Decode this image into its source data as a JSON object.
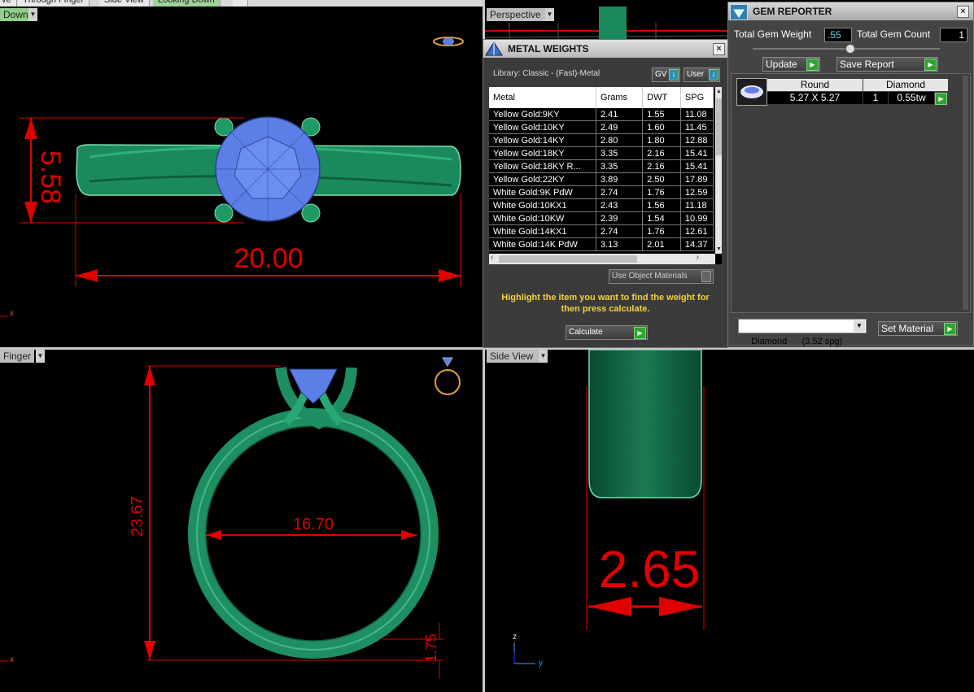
{
  "tabs": [
    {
      "label": "ve"
    },
    {
      "label": "Through Finger"
    },
    {
      "label": "Side View"
    },
    {
      "label": "Looking Down"
    }
  ],
  "viewports": {
    "top_left": {
      "label": "Down",
      "dim_height": "5.58",
      "dim_width": "20.00",
      "axis": "x"
    },
    "top_right": {
      "label": "Perspective"
    },
    "bottom_left": {
      "label": "Finger",
      "dim_height": "23.67",
      "dim_inner": "16.70",
      "dim_band": "1.75",
      "axis": "x"
    },
    "bottom_right": {
      "label": "Side View",
      "dim_width": "2.65",
      "axis_z": "z",
      "axis_y": "y"
    }
  },
  "metal_weights": {
    "title": "METAL WEIGHTS",
    "library": "Library: Classic - (Fast)-Metal",
    "gv_label": "GV",
    "user_label": "User",
    "columns": [
      "Metal",
      "Grams",
      "DWT",
      "SPG"
    ],
    "rows": [
      [
        "Yellow Gold:9KY",
        "2.41",
        "1.55",
        "11.08"
      ],
      [
        "Yellow Gold:10KY",
        "2.49",
        "1.60",
        "11.45"
      ],
      [
        "Yellow Gold:14KY",
        "2.80",
        "1.80",
        "12.88"
      ],
      [
        "Yellow Gold:18KY",
        "3.35",
        "2.16",
        "15.41"
      ],
      [
        "Yellow Gold:18KY R...",
        "3.35",
        "2.16",
        "15.41"
      ],
      [
        "Yellow Gold:22KY",
        "3.89",
        "2.50",
        "17.89"
      ],
      [
        "White Gold:9K PdW",
        "2.74",
        "1.76",
        "12.59"
      ],
      [
        "White Gold:10KX1",
        "2.43",
        "1.56",
        "11.18"
      ],
      [
        "White Gold:10KW",
        "2.39",
        "1.54",
        "10.99"
      ],
      [
        "White Gold:14KX1",
        "2.74",
        "1.76",
        "12.61"
      ],
      [
        "White Gold:14K PdW",
        "3.13",
        "2.01",
        "14.37"
      ]
    ],
    "use_object_materials": "Use Object Materials",
    "instruction": "Highlight the item you want to find the weight for then press calculate.",
    "calculate_label": "Calculate"
  },
  "gem_reporter": {
    "title": "GEM REPORTER",
    "total_weight_label": "Total Gem Weight",
    "total_weight_value": ".55",
    "total_count_label": "Total Gem Count",
    "total_count_value": "1",
    "update_label": "Update",
    "save_report_label": "Save Report",
    "gem_shape": "Round",
    "gem_type": "Diamond",
    "gem_size": "5.27 X 5.27",
    "gem_qty": "1",
    "gem_weight": "0.55tw",
    "material_select": "Diamond      (3.52 spg)",
    "set_material_label": "Set Material"
  },
  "colors": {
    "metal": "#1e8f62",
    "gem": "#5b7fe6",
    "dimension": "#e00000",
    "accent_green": "#8fcf8a",
    "instruction_yellow": "#f2d23a"
  }
}
